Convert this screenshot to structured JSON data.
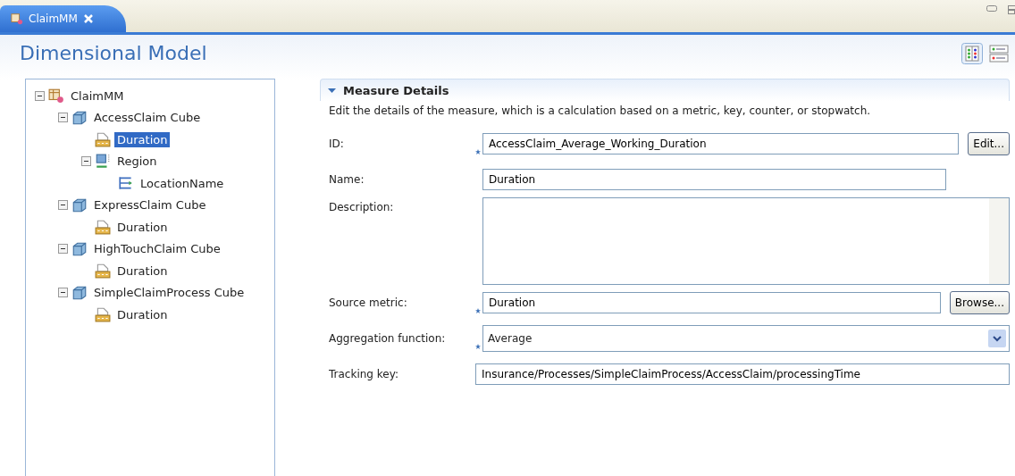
{
  "tab": {
    "title": "ClaimMM",
    "selected": true
  },
  "header": {
    "title": "Dimensional Model"
  },
  "tree": [
    {
      "label": "ClaimMM",
      "kind": "model",
      "expanded": true,
      "selected": false,
      "children": [
        {
          "label": "AccessClaim Cube",
          "kind": "cube",
          "expanded": true,
          "selected": false,
          "children": [
            {
              "label": "Duration",
              "kind": "measure",
              "selected": true
            },
            {
              "label": "Region",
              "kind": "dimension",
              "expanded": true,
              "selected": false,
              "children": [
                {
                  "label": "LocationName",
                  "kind": "level",
                  "selected": false
                }
              ]
            }
          ]
        },
        {
          "label": "ExpressClaim Cube",
          "kind": "cube",
          "expanded": true,
          "selected": false,
          "children": [
            {
              "label": "Duration",
              "kind": "measure",
              "selected": false
            }
          ]
        },
        {
          "label": "HighTouchClaim Cube",
          "kind": "cube",
          "expanded": true,
          "selected": false,
          "children": [
            {
              "label": "Duration",
              "kind": "measure",
              "selected": false
            }
          ]
        },
        {
          "label": "SimpleClaimProcess Cube",
          "kind": "cube",
          "expanded": true,
          "selected": false,
          "children": [
            {
              "label": "Duration",
              "kind": "measure",
              "selected": false
            }
          ]
        }
      ]
    }
  ],
  "section": {
    "title": "Measure Details",
    "expanded": true,
    "description": "Edit the details of the measure, which is a calculation based on a metric, key, counter, or stopwatch.",
    "fields": [
      {
        "label": "ID:",
        "kind": "input",
        "required": true,
        "value": "AccessClaim_Average_Working_Duration",
        "button": "Edit..."
      },
      {
        "label": "Name:",
        "kind": "input",
        "required": false,
        "value": "Duration"
      },
      {
        "label": "Description:",
        "kind": "textarea",
        "required": false
      },
      {
        "label": "Source metric:",
        "kind": "input",
        "required": true,
        "value": "Duration",
        "button": "Browse..."
      },
      {
        "label": "Aggregation function:",
        "kind": "combo",
        "required": true,
        "value": "Average"
      },
      {
        "label": "Tracking key:",
        "kind": "wide",
        "required": false,
        "value": "Insurance/Processes/SimpleClaimProcess/AccessClaim/processingTime"
      }
    ]
  }
}
